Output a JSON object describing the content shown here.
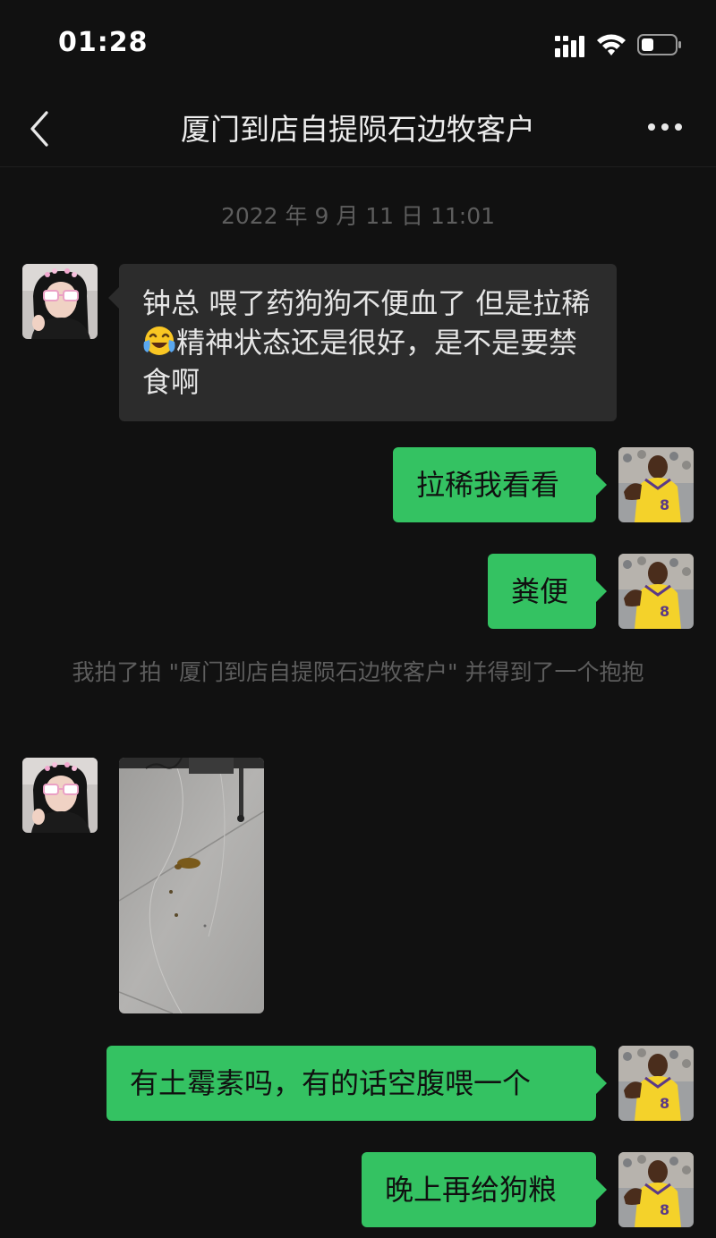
{
  "status_bar": {
    "time": "01:28"
  },
  "header": {
    "title": "厦门到店自提陨石边牧客户"
  },
  "timestamp": "2022 年 9 月 11 日 11:01",
  "system_message": "我拍了拍 \"厦门到店自提陨石边牧客户\" 并得到了一个抱抱",
  "messages": [
    {
      "from": "contact",
      "text_before": "钟总 喂了药狗狗不便血了 但是拉稀",
      "emoji": "crying-laughing",
      "text_after": "精神状态还是很好，是不是要禁食啊"
    },
    {
      "from": "me",
      "text": "拉稀我看看"
    },
    {
      "from": "me",
      "text": "粪便"
    },
    {
      "from": "contact",
      "type": "image"
    },
    {
      "from": "me",
      "text": "有土霉素吗，有的话空腹喂一个"
    },
    {
      "from": "me",
      "text": "晚上再给狗粮"
    }
  ],
  "colors": {
    "background": "#111111",
    "incoming_bubble": "#2c2c2c",
    "outgoing_bubble": "#34c262",
    "system_text": "#5d5d5d"
  }
}
